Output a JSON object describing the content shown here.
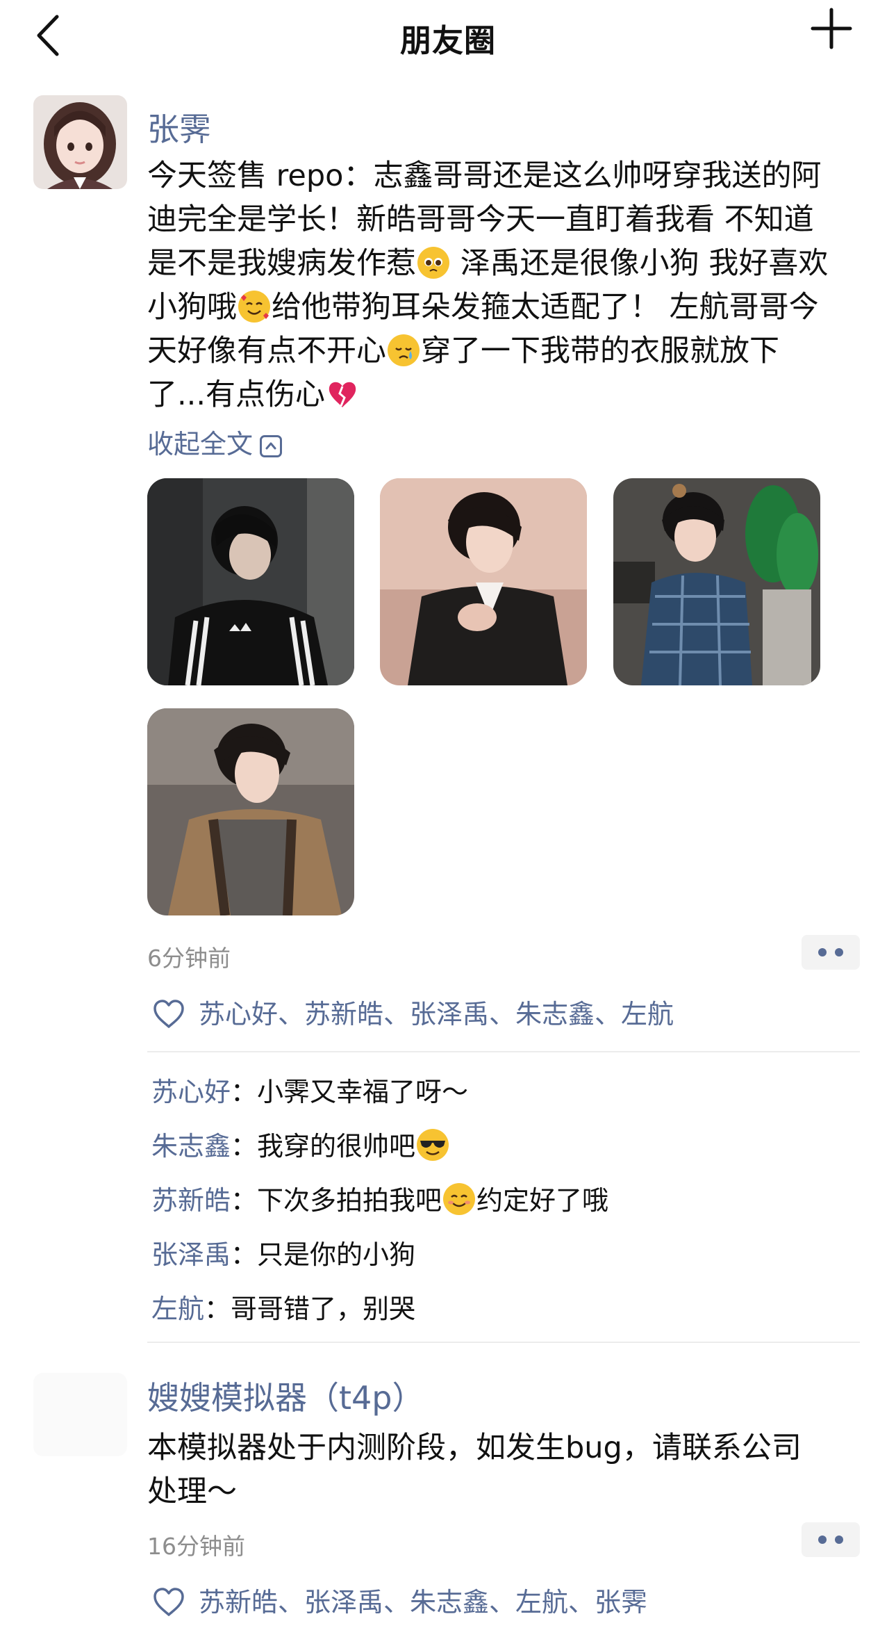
{
  "nav": {
    "title": "朋友圈"
  },
  "post1": {
    "username": "张霁",
    "lines": [
      "今天签售 repo：志鑫哥哥还是这么帅呀穿我送的阿",
      "迪完全是学长！新皓哥哥今天一直盯着我看 不知道",
      "是不是我嫂病发作惹",
      " 泽禹还是很像小狗 我好喜欢",
      "小狗哦",
      "给他带狗耳朵发箍太适配了！ 左航哥哥今",
      "天好像有点不开心",
      "穿了一下我带的衣服就放下",
      "了...有点伤心"
    ],
    "collapse_label": "收起全文",
    "time": "6分钟前",
    "likes": "苏心好、苏新皓、张泽禹、朱志鑫、左航",
    "comments": [
      {
        "name": "苏心好",
        "sep": "：",
        "text": "小霁又幸福了呀～",
        "text2": ""
      },
      {
        "name": "朱志鑫",
        "sep": "：",
        "text": "我穿的很帅吧",
        "text2": ""
      },
      {
        "name": "苏新皓",
        "sep": "：",
        "text": "下次多拍拍我吧",
        "text2": "约定好了哦"
      },
      {
        "name": "张泽禹",
        "sep": "：",
        "text": "只是你的小狗",
        "text2": ""
      },
      {
        "name": "左航",
        "sep": "：",
        "text": "哥哥错了，别哭",
        "text2": ""
      }
    ]
  },
  "post2": {
    "username": "嫂嫂模拟器（t4p）",
    "lines": [
      "本模拟器处于内测阶段，如发生bug，请联系公司",
      "处理～"
    ],
    "time": "16分钟前",
    "likes": "苏新皓、张泽禹、朱志鑫、左航、张霁"
  },
  "colors": {
    "link": "#576b95",
    "time": "#8d8d8d",
    "text": "#111111"
  },
  "icons": {
    "back": "back-chevron-icon",
    "add": "plus-icon",
    "like": "heart-outline-icon",
    "more": "more-dots-icon",
    "collapse": "chevron-up-box-icon"
  }
}
